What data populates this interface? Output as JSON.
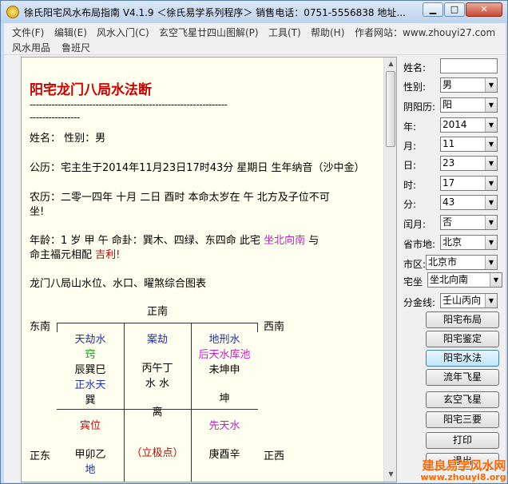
{
  "window": {
    "title": "徐氏阳宅风水布局指南 V4.1.9 ＜徐氏易学系列程序＞ 销售电话：0751-5556838  地址..."
  },
  "menu": {
    "row1": [
      "文件(F)",
      "编辑(E)",
      "风水入门(C)",
      "玄空飞星廿四山图解(P)",
      "工具(T)",
      "帮助(H)",
      "作者网站：www.zhouyi27.com"
    ],
    "row2": [
      "风水用品",
      "鲁班尺"
    ]
  },
  "doc": {
    "title": "阳宅龙门八局水法断",
    "dashes": "---------------------------------------------------------------",
    "dashes2": "----------------",
    "name_line": "姓名：  性别：男",
    "gregorian": "公历：宅主生于2014年11月23日17时43分 星期日 生年纳音（沙中金）",
    "lunar1": "农历：二零一四年  十月  二日  酉时    本命太岁在  午    北方及子位不可",
    "lunar2": "坐!",
    "age_prefix": "年龄：1 岁    甲  午    命卦：巽木、四绿、东四命    此宅 ",
    "age_orient": "坐北向南",
    "age_suffix": " 与",
    "fortune_prefix": "命主福元相配 ",
    "fortune_word": "吉利!",
    "chart_heading": "龙门八局山水位、水口、曜煞综合图表",
    "directions": {
      "south": "正南",
      "southeast": "东南",
      "southwest": "西南",
      "east": "正东",
      "west": "正西"
    },
    "cells": {
      "se": [
        "天劫水",
        "窍",
        "辰巽巳",
        "正水天",
        "巽"
      ],
      "s": [
        "案劫",
        "丙午丁",
        "水  水",
        "离"
      ],
      "sw": [
        "地刑水",
        "后天水库池",
        "未坤申",
        "坤"
      ],
      "e": [
        "宾位",
        "甲卯乙",
        "地"
      ],
      "center": [
        "（立极点）"
      ],
      "w": [
        "先天水",
        "庚酉辛"
      ]
    }
  },
  "sidebar": {
    "name_label": "姓名:",
    "name_value": "",
    "gender_label": "性别:",
    "gender_value": "男",
    "calendar_label": "阴阳历:",
    "calendar_value": "阳",
    "year_label": "年:",
    "year_value": "2014",
    "month_label": "月:",
    "month_value": "11",
    "day_label": "日:",
    "day_value": "23",
    "hour_label": "时:",
    "hour_value": "17",
    "minute_label": "分:",
    "minute_value": "43",
    "leap_label": "闰月:",
    "leap_value": "否",
    "province_label": "省市地:",
    "province_value": "北京",
    "district_label": "市区:",
    "district_value": "北京市",
    "sit_label": "宅坐",
    "sit_value": "坐北向南",
    "split_label": "分金线:",
    "split_value": "壬山丙向",
    "buttons": [
      "阳宅布局",
      "阳宅鉴定",
      "阳宅水法",
      "流年飞星",
      "玄空飞星",
      "阳宅三要",
      "打印",
      "退出"
    ]
  },
  "watermark": {
    "text": "建良易学风水网",
    "url": "www.zhouyi8.org"
  }
}
